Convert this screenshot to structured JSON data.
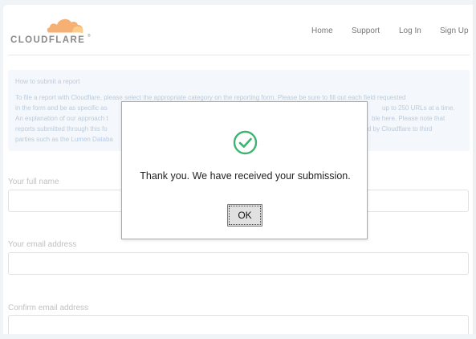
{
  "header": {
    "logo_text": "CLOUDFLARE",
    "logo_registered": "®",
    "nav": [
      "Home",
      "Support",
      "Log In",
      "Sign Up"
    ]
  },
  "info": {
    "title": "How to submit a report",
    "lines": [
      {
        "pre": "To file a report with Cloudflare, please select the appropriate category on the reporting form. Please be sure to fill out each field requested",
        "link": "",
        "post": ""
      },
      {
        "pre": "in the form and be as specific as",
        "link": "",
        "post": "",
        "tail": "up to 250 URLs at a time."
      },
      {
        "pre": "An explanation of our approach t",
        "link": "",
        "post": "",
        "tail_pre": "ble ",
        "tail_link": "here",
        "tail_post": ". Please note that"
      },
      {
        "pre": "reports submitted through this fo",
        "link": "",
        "post": "",
        "tail": "d by Cloudflare to third"
      },
      {
        "pre": "parties such as the ",
        "link": "Lumen Databa",
        "post": ""
      }
    ]
  },
  "form": {
    "full_name_label": "Your full name",
    "email_label": "Your email address",
    "confirm_email_label": "Confirm email address"
  },
  "dialog": {
    "message": "Thank you. We have received your submission.",
    "ok_label": "OK"
  },
  "colors": {
    "brand_orange": "#f38020",
    "brand_orange_light": "#faad3f",
    "success_green": "#3cb371"
  },
  "icons": {
    "dialog_icon": "check-circle-icon",
    "logo_icon": "cloud-icon"
  }
}
